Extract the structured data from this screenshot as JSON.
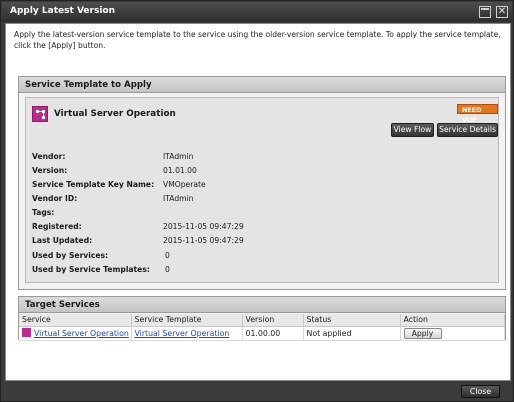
{
  "window": {
    "title": "Apply Latest Version",
    "close_glyph": "✕"
  },
  "intro": {
    "text": "Apply the latest-version service template to the service using the older-version service template. To apply the service template, click the [Apply] button."
  },
  "template_panel": {
    "heading": "Service Template to Apply",
    "service_name": "Virtual Server Operation",
    "service_icon": "service-template-icon",
    "badge": "NEED VUP",
    "buttons": {
      "view_flow": "View Flow",
      "service_details": "Service Details"
    },
    "properties": [
      {
        "label": "Vendor:",
        "value": "ITAdmin"
      },
      {
        "label": "Version:",
        "value": "01.01.00"
      },
      {
        "label": "Service Template Key Name:",
        "value": "VMOperate"
      },
      {
        "label": "Vendor ID:",
        "value": "ITAdmin"
      },
      {
        "label": "Tags:",
        "value": ""
      },
      {
        "label": "Registered:",
        "value": "2015-11-05 09:47:29"
      },
      {
        "label": "Last Updated:",
        "value": "2015-11-05 09:47:29"
      },
      {
        "label": "Used by Services:",
        "value": "0"
      },
      {
        "label": "Used by Service Templates:",
        "value": "0"
      }
    ]
  },
  "target_panel": {
    "heading": "Target Services",
    "columns": [
      "Service",
      "Service Template",
      "Version",
      "Status",
      "Action"
    ],
    "rows": [
      {
        "service": "Virtual Server Operation",
        "service_template": "Virtual Server Operation",
        "version": "01.00.00",
        "status": "Not applied",
        "action": "Apply"
      }
    ]
  },
  "footer": {
    "close_label": "Close"
  },
  "colors": {
    "accent_magenta": "#c02890",
    "badge_orange": "#e6731e",
    "link_blue": "#1846b8",
    "chrome_dark": "#3b3b3b"
  }
}
